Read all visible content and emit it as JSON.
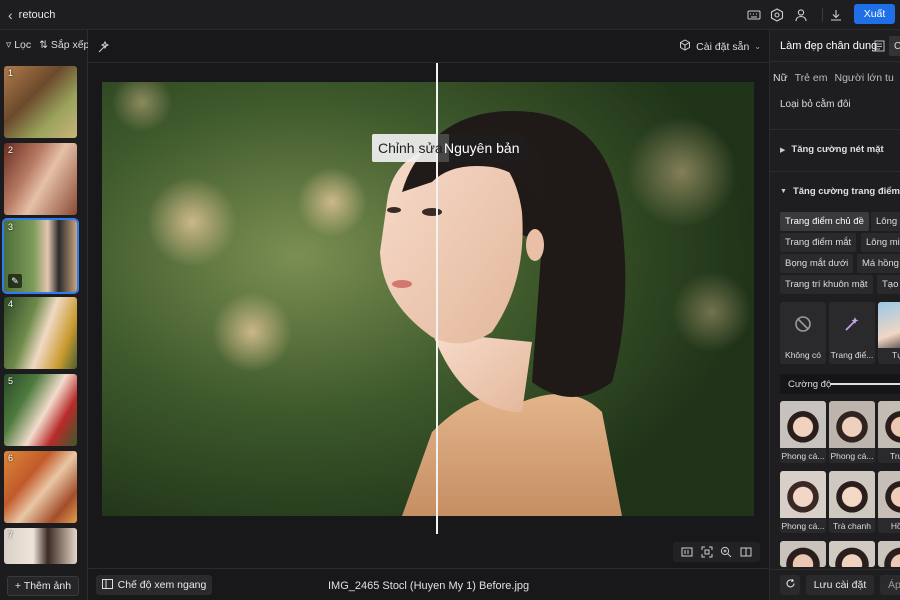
{
  "topbar": {
    "back_label": "retouch",
    "export_label": "Xuất",
    "icons": [
      "keyboard-icon",
      "settings-icon",
      "user-icon",
      "download-icon"
    ]
  },
  "left": {
    "filter_label": "Lọc",
    "sort_label": "Sắp xếp",
    "thumbnails": [
      "1",
      "2",
      "3",
      "4",
      "5",
      "6",
      "7"
    ],
    "selected_index": 3,
    "add_photo_label": "+ Thêm ảnh"
  },
  "center": {
    "preset_label": "Cài đặt sẵn",
    "edited_label": "Chỉnh sửa",
    "original_label": "Nguyên bản",
    "view_mode_label": "Chế độ xem ngang",
    "filename": "IMG_2465 Stocl (Huyen My 1) Before.jpg"
  },
  "right": {
    "title": "Làm đẹp chân dung",
    "title_button": "Cl",
    "tabs": [
      "Nữ",
      "Trẻ em",
      "Người lớn tu"
    ],
    "remove_label": "Loại bỏ cằm đôi",
    "section_face": "Tăng cường nét mặt",
    "section_makeup": "Tăng cường trang điểm",
    "chips": [
      [
        "Trang điểm chủ đề",
        "Lông"
      ],
      [
        "Trang điểm mắt",
        "Lông mi"
      ],
      [
        "Bọng mắt dưới",
        "Má hồng"
      ],
      [
        "Trang trí khuôn mặt",
        "Tạo k"
      ]
    ],
    "cards": [
      "Không có",
      "Trang điể...",
      "Tự n"
    ],
    "intensity_label": "Cường độ",
    "styles_row1": [
      "Phong cá...",
      "Phong cá...",
      "Trung"
    ],
    "styles_row2": [
      "Phong cá...",
      "Trà chanh",
      "Hồng"
    ],
    "save_label": "Lưu cài đặt",
    "apply_label": "Áp"
  }
}
